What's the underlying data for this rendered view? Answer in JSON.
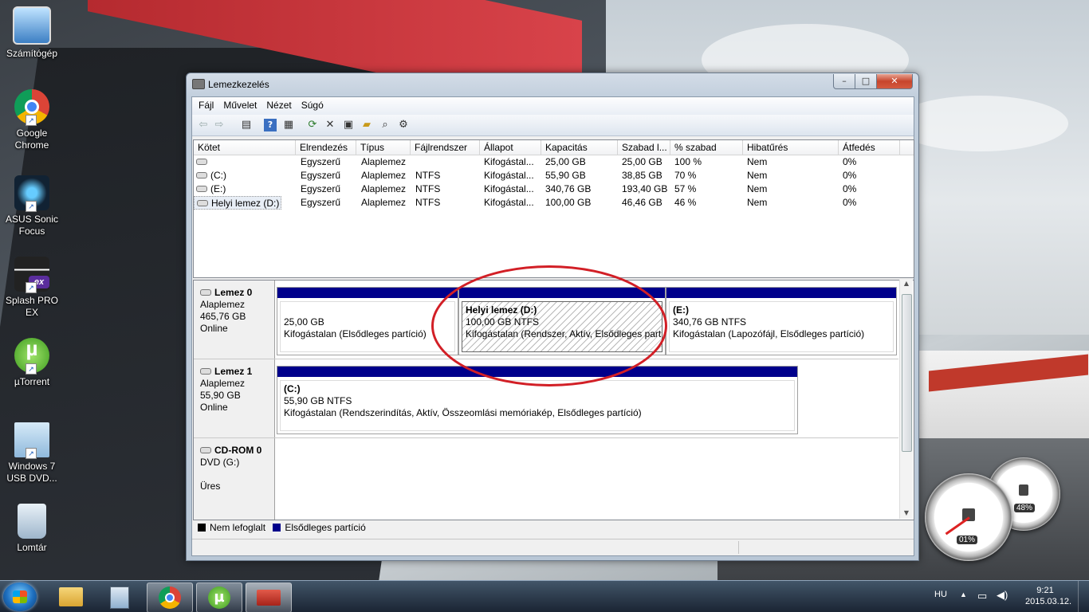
{
  "desktop": {
    "icons": [
      {
        "label": "Számítógép"
      },
      {
        "label": "Google Chrome"
      },
      {
        "label": "ASUS Sonic Focus"
      },
      {
        "label": "Splash PRO EX"
      },
      {
        "label": "µTorrent"
      },
      {
        "label": "Windows 7 USB DVD..."
      },
      {
        "label": "Lomtár"
      }
    ]
  },
  "window": {
    "title": "Lemezkezelés",
    "menu": [
      "Fájl",
      "Művelet",
      "Nézet",
      "Súgó"
    ],
    "columns": [
      "Kötet",
      "Elrendezés",
      "Típus",
      "Fájlrendszer",
      "Állapot",
      "Kapacitás",
      "Szabad l...",
      "% szabad",
      "Hibatűrés",
      "Átfedés"
    ],
    "rows": [
      [
        "",
        "Egyszerű",
        "Alaplemez",
        "",
        "Kifogástal...",
        "25,00 GB",
        "25,00 GB",
        "100 %",
        "Nem",
        "0%"
      ],
      [
        "(C:)",
        "Egyszerű",
        "Alaplemez",
        "NTFS",
        "Kifogástal...",
        "55,90 GB",
        "38,85 GB",
        "70 %",
        "Nem",
        "0%"
      ],
      [
        "(E:)",
        "Egyszerű",
        "Alaplemez",
        "NTFS",
        "Kifogástal...",
        "340,76 GB",
        "193,40 GB",
        "57 %",
        "Nem",
        "0%"
      ],
      [
        "Helyi lemez (D:)",
        "Egyszerű",
        "Alaplemez",
        "NTFS",
        "Kifogástal...",
        "100,00 GB",
        "46,46 GB",
        "46 %",
        "Nem",
        "0%"
      ]
    ],
    "disks": [
      {
        "name": "Lemez 0",
        "type": "Alaplemez",
        "size": "465,76 GB",
        "status": "Online",
        "partitions": [
          {
            "title": "",
            "size": "25,00 GB",
            "status": "Kifogástalan (Elsődleges partíció)"
          },
          {
            "title": "Helyi lemez  (D:)",
            "size": "100,00 GB NTFS",
            "status": "Kifogástalan (Rendszer, Aktív, Elsődleges partíció)"
          },
          {
            "title": "(E:)",
            "size": "340,76 GB NTFS",
            "status": "Kifogástalan (Lapozófájl, Elsődleges partíció)"
          }
        ]
      },
      {
        "name": "Lemez 1",
        "type": "Alaplemez",
        "size": "55,90 GB",
        "status": "Online",
        "partitions": [
          {
            "title": "(C:)",
            "size": "55,90 GB NTFS",
            "status": "Kifogástalan (Rendszerindítás, Aktív, Összeomlási memóriakép, Elsődleges partíció)"
          }
        ]
      },
      {
        "name": "CD-ROM 0",
        "type": "DVD (G:)",
        "status": "Üres"
      }
    ],
    "legend": [
      {
        "label": "Nem lefoglalt",
        "color": "#000000"
      },
      {
        "label": "Elsődleges partíció",
        "color": "#00008b"
      }
    ]
  },
  "gadget": {
    "cpu": "01%",
    "memory": "48%"
  },
  "taskbar": {
    "language": "HU",
    "time": "9:21",
    "date": "2015.03.12."
  }
}
